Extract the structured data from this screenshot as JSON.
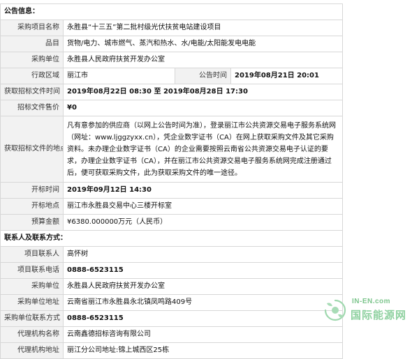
{
  "section_announcement": "公告信息：",
  "rows_top": [
    {
      "label": "采购项目名称",
      "value": "永胜县“十三五”第二批村级光伏扶贫电站建设项目"
    },
    {
      "label": "品目",
      "value": "货物/电力、城市燃气、蒸汽和热水、水/电能/太阳能发电电能"
    },
    {
      "label": "采购单位",
      "value": "永胜县人民政府扶贫开发办公室"
    }
  ],
  "region": {
    "label": "行政区域",
    "value": "丽江市",
    "date_label": "公告时间",
    "date_value": "2019年08月21日 20:01"
  },
  "rows_mid": [
    {
      "label": "获取招标文件时间",
      "value": "2019年08月22日 08:30  至  2019年08月28日 17:30"
    },
    {
      "label": "招标文件售价",
      "value": "¥0"
    }
  ],
  "location_doc": {
    "label": "获取招标文件的地点",
    "value": "凡有意参加的供应商（以网上公告时间为准），登录丽江市公共资源交易电子服务系统网（网址：www.ljggzyxx.cn），凭企业数字证书（CA）在网上获取采购文件及其它采购资料。未办理企业数字证书（CA）的企业需要按照云南省公共资源交易电子认证的要求，办理企业数字证书（CA），并在丽江市公共资源交易电子服务系统网完成注册通过后，便可获取采购文件，此为获取采购文件的唯一途径。"
  },
  "rows_bottom": [
    {
      "label": "开标时间",
      "value": "2019年09月12日 14:30"
    },
    {
      "label": "开标地点",
      "value": "丽江市永胜县交易中心三楼开标室"
    },
    {
      "label": "预算金额",
      "value": "¥6380.000000万元（人民币）"
    }
  ],
  "section_contact": "联系人及联系方式：",
  "rows_contact": [
    {
      "label": "项目联系人",
      "value": "高怀树"
    },
    {
      "label": "项目联系电话",
      "value": "0888-6523115"
    },
    {
      "label": "采购单位",
      "value": "永胜县人民政府扶贫开发办公室"
    },
    {
      "label": "采购单位地址",
      "value": "云南省丽江市永胜县永北镇凤鸣路409号"
    },
    {
      "label": "采购单位联系方式",
      "value": "0888-6523115"
    },
    {
      "label": "代理机构名称",
      "value": "云南鑫德招标咨询有限公司"
    },
    {
      "label": "代理机构地址",
      "value": "丽江分公司地址:锦上城西区25栋"
    }
  ],
  "watermark": {
    "en": "IN-EN.com",
    "cn": "国际能源网",
    "color": "#8fd1a0"
  }
}
